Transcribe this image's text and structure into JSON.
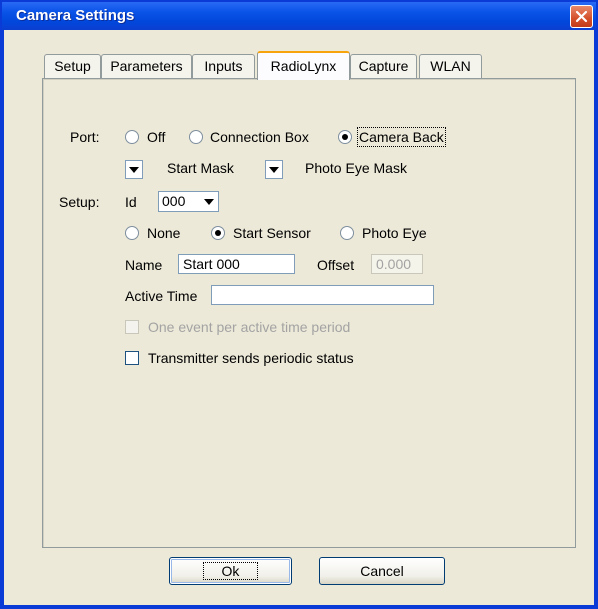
{
  "window": {
    "title": "Camera Settings"
  },
  "tabs": [
    {
      "label": "Setup"
    },
    {
      "label": "Parameters"
    },
    {
      "label": "Inputs"
    },
    {
      "label": "RadioLynx",
      "active": true
    },
    {
      "label": "Capture"
    },
    {
      "label": "WLAN"
    }
  ],
  "port": {
    "label": "Port:",
    "options": [
      "Off",
      "Connection Box",
      "Camera Back"
    ],
    "selected": "Camera Back",
    "start_mask_label": "Start Mask",
    "photo_eye_mask_label": "Photo Eye Mask"
  },
  "setup": {
    "label": "Setup:",
    "id_label": "Id",
    "id_value": "000",
    "type_options": [
      "None",
      "Start Sensor",
      "Photo Eye"
    ],
    "type_selected": "Start Sensor",
    "name_label": "Name",
    "name_value": "Start 000",
    "offset_label": "Offset",
    "offset_value": "0.000",
    "active_time_label": "Active Time",
    "active_time_value": "",
    "one_event_label": "One event per active time period",
    "periodic_status_label": "Transmitter sends periodic status"
  },
  "buttons": {
    "ok": "Ok",
    "cancel": "Cancel"
  },
  "colors": {
    "titlebar": "#0a54e8",
    "dialog_bg": "#ece9d8",
    "tab_highlight": "#f7a30c"
  },
  "icons": {
    "close": "close-icon",
    "dropdown": "chevron-down-icon"
  }
}
